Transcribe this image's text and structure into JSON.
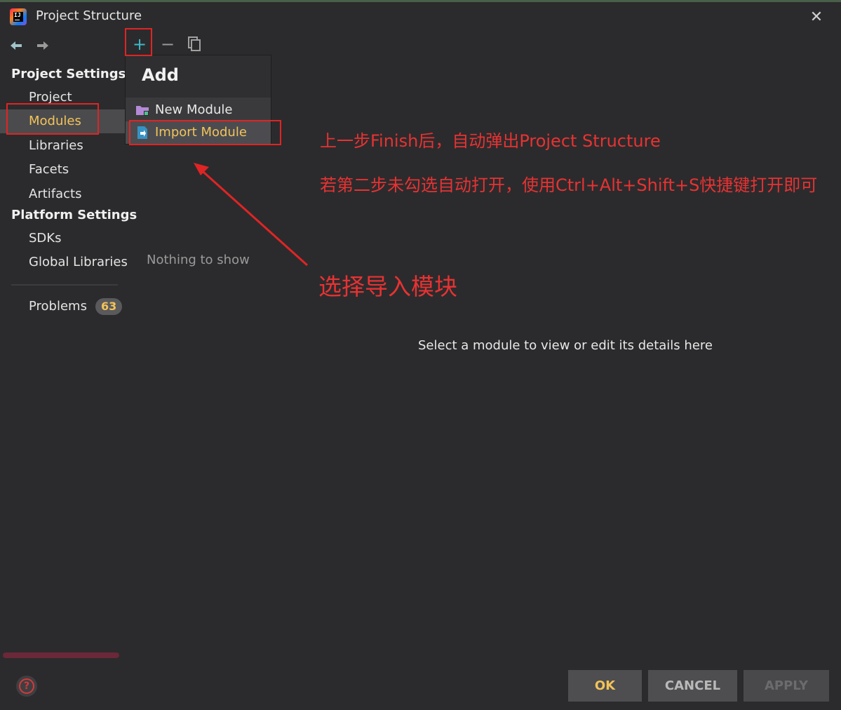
{
  "window": {
    "title": "Project Structure",
    "close_glyph": "✕"
  },
  "toolbar": {
    "add_glyph": "+",
    "remove_glyph": "−"
  },
  "sidebar": {
    "project_settings_header": "Project Settings",
    "project_items": [
      {
        "label": "Project"
      },
      {
        "label": "Modules",
        "selected": true
      },
      {
        "label": "Libraries"
      },
      {
        "label": "Facets"
      },
      {
        "label": "Artifacts"
      }
    ],
    "platform_settings_header": "Platform Settings",
    "platform_items": [
      {
        "label": "SDKs"
      },
      {
        "label": "Global Libraries"
      }
    ],
    "problems": {
      "label": "Problems",
      "count": "63"
    }
  },
  "add_popup": {
    "title": "Add",
    "items": [
      {
        "label": "New Module",
        "icon": "folder-module-icon"
      },
      {
        "label": "Import Module",
        "icon": "import-module-icon",
        "highlighted": true
      }
    ]
  },
  "module_list": {
    "empty_text": "Nothing to show"
  },
  "details": {
    "placeholder": "Select a module to view or edit its details here"
  },
  "annotations": {
    "line1": "上一步Finish后，自动弹出Project Structure",
    "line2": "若第二步未勾选自动打开，使用Ctrl+Alt+Shift+S快捷键打开即可",
    "line3": "选择导入模块",
    "color": "#e83232"
  },
  "footer": {
    "ok": "OK",
    "cancel": "CANCEL",
    "apply": "APPLY",
    "help_glyph": "?"
  },
  "colors": {
    "accent": "#f2c35a",
    "background": "#2b2b2d",
    "add_icon": "#3fb8c9",
    "annotation_red": "#e02424"
  }
}
